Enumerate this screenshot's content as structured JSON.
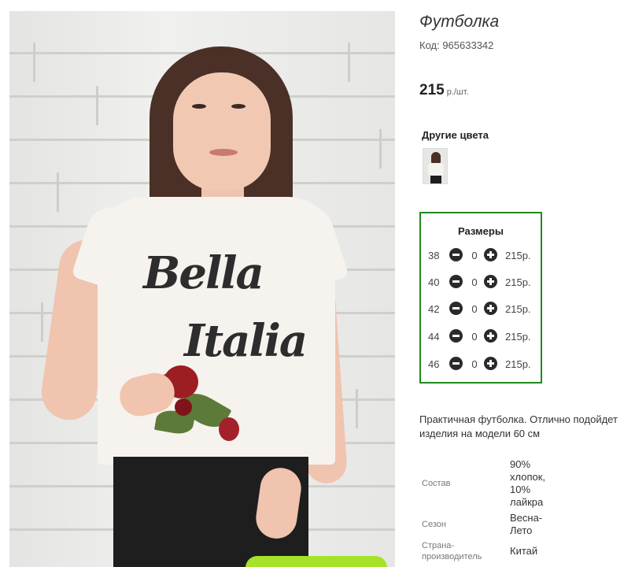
{
  "product": {
    "title": "Футболка",
    "code": "Код: 965633342",
    "price": "215",
    "price_unit": "р./шт."
  },
  "colors": {
    "title": "Другие цвета"
  },
  "sizes": {
    "title": "Размеры",
    "rows": [
      {
        "size": "38",
        "qty": "0",
        "price": "215р."
      },
      {
        "size": "40",
        "qty": "0",
        "price": "215р."
      },
      {
        "size": "42",
        "qty": "0",
        "price": "215р."
      },
      {
        "size": "44",
        "qty": "0",
        "price": "215р."
      },
      {
        "size": "46",
        "qty": "0",
        "price": "215р."
      }
    ]
  },
  "description": {
    "line1": "Практичная футболка. Отлично подойдет",
    "line2": "изделия на модели 60 см"
  },
  "specs": [
    {
      "label": "Состав",
      "value": "90% хлопок, 10% лайкра"
    },
    {
      "label": "Сезон",
      "value": "Весна-Лето"
    },
    {
      "label": "Страна-производитель",
      "value": "Китай"
    }
  ],
  "image": {
    "shirt_text_1": "Bella",
    "shirt_text_2": "Italia"
  },
  "icons": {
    "minus": "minus-circle-icon",
    "plus": "plus-circle-icon"
  },
  "colors_palette": {
    "accent_border": "#21891f",
    "cart_button": "#a6e22a"
  }
}
